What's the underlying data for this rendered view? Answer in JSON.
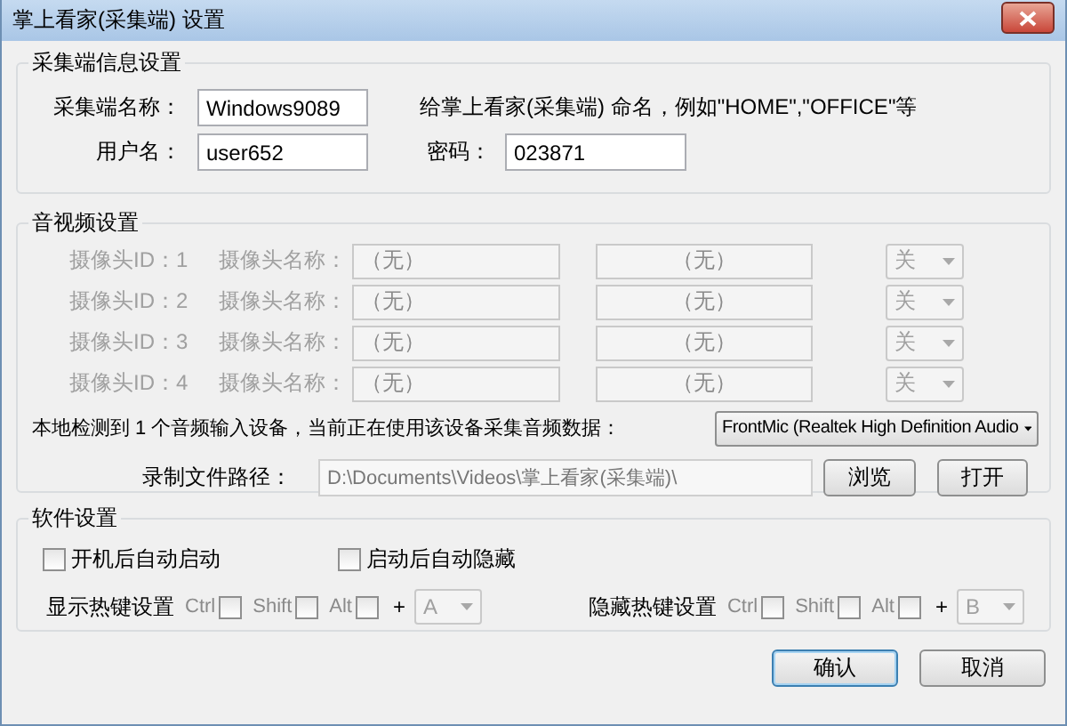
{
  "window": {
    "title": "掌上看家(采集端) 设置"
  },
  "client_info": {
    "title": "采集端信息设置",
    "name_label": "采集端名称：",
    "name_value": "Windows9089",
    "hint": "给掌上看家(采集端) 命名，例如\"HOME\",\"OFFICE\"等",
    "user_label": "用户名：",
    "user_value": "user652",
    "password_label": "密码：",
    "password_value": "023871"
  },
  "av": {
    "title": "音视频设置",
    "cameras": [
      {
        "id_label": "摄像头ID：1",
        "name_label": "摄像头名称：",
        "name_value": "（无）",
        "field_2": "（无）",
        "switch": "关",
        "disabled": true
      },
      {
        "id_label": "摄像头ID：2",
        "name_label": "摄像头名称：",
        "name_value": "（无）",
        "field_2": "（无）",
        "switch": "关",
        "disabled": true
      },
      {
        "id_label": "摄像头ID：3",
        "name_label": "摄像头名称：",
        "name_value": "（无）",
        "field_2": "（无）",
        "switch": "关",
        "disabled": true
      },
      {
        "id_label": "摄像头ID：4",
        "name_label": "摄像头名称：",
        "name_value": "（无）",
        "field_2": "（无）",
        "switch": "关",
        "disabled": true
      }
    ],
    "audio_text": "本地检测到 1 个音频输入设备，当前正在使用该设备采集音频数据：",
    "audio_device": "FrontMic (Realtek High Definition Audio",
    "path_label": "录制文件路径：",
    "path_value": "D:\\Documents\\Videos\\掌上看家(采集端)\\",
    "browse": "浏览",
    "open": "打开"
  },
  "software": {
    "title": "软件设置",
    "options": [
      {
        "label": "开机后自动启动",
        "checked": false
      },
      {
        "label": "启动后自动隐藏",
        "checked": false
      }
    ],
    "hotkeys": [
      {
        "label": "显示热键设置",
        "modifiers": [
          {
            "label": "Ctrl",
            "checked": false
          },
          {
            "label": "Shift",
            "checked": false
          },
          {
            "label": "Alt",
            "checked": false
          }
        ],
        "plus": "+",
        "key": "A"
      },
      {
        "label": "隐藏热键设置",
        "modifiers": [
          {
            "label": "Ctrl",
            "checked": false
          },
          {
            "label": "Shift",
            "checked": false
          },
          {
            "label": "Alt",
            "checked": false
          }
        ],
        "plus": "+",
        "key": "B"
      }
    ]
  },
  "buttons": [
    {
      "label": "确认",
      "default": true
    },
    {
      "label": "取消",
      "default": false
    }
  ]
}
